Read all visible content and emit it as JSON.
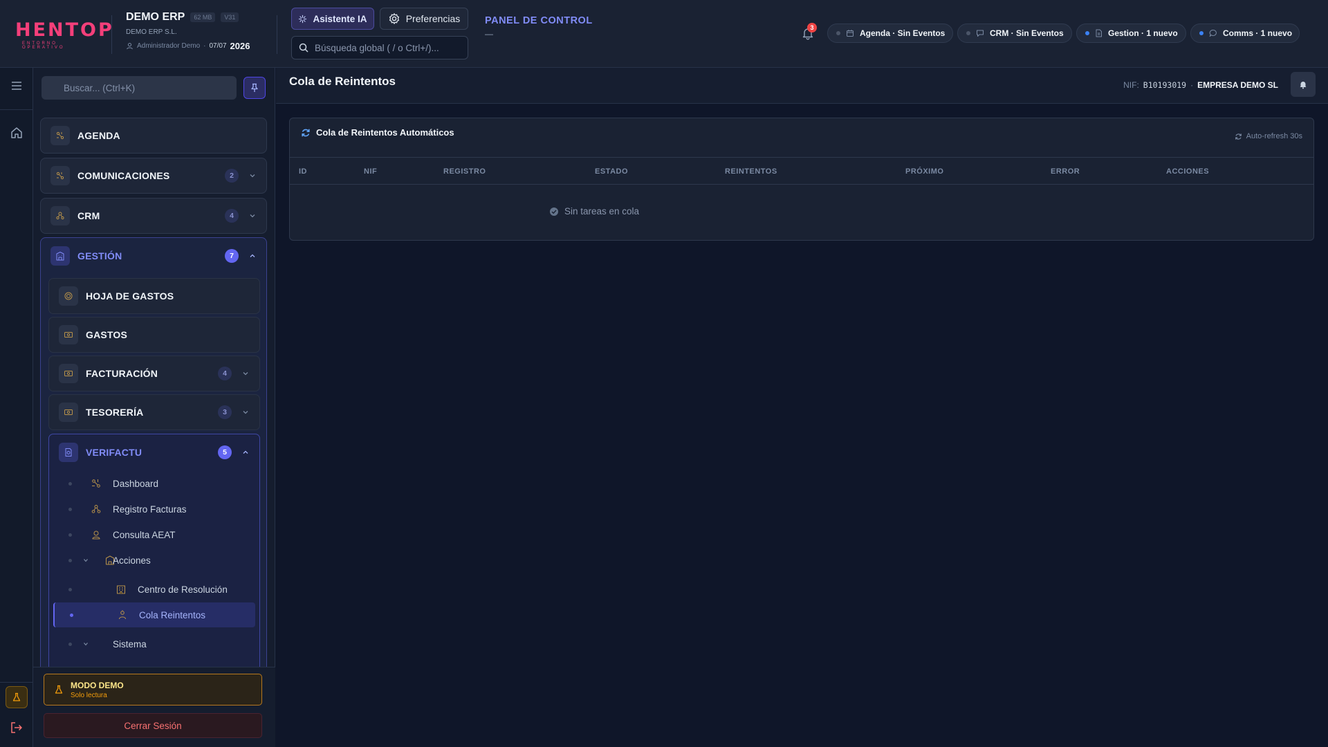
{
  "header": {
    "logo": "HENTOP",
    "logo_sub": "ENTORNO OPERATIVO",
    "app_title": "DEMO ERP",
    "memory_tag": "62 MB",
    "version_tag": "V31",
    "company": "DEMO ERP S.L.",
    "user": "Administrador Demo",
    "date": "07/07",
    "year": "2026",
    "ai_button": "Asistente IA",
    "prefs_button": "Preferencias",
    "search_placeholder": "Búsqueda global ( / o Ctrl+/)...",
    "panel_title": "PANEL DE CONTROL",
    "panel_sub": "—",
    "notifications_count": "3",
    "pills": [
      {
        "label": "Agenda · Sin Eventos",
        "icon": "calendar-icon",
        "status": "idle"
      },
      {
        "label": "CRM · Sin Eventos",
        "icon": "chat-icon",
        "status": "idle"
      },
      {
        "label": "Gestion · 1 nuevo",
        "icon": "document-icon",
        "status": "new"
      },
      {
        "label": "Comms · 1 nuevo",
        "icon": "message-icon",
        "status": "new"
      }
    ]
  },
  "sidebar": {
    "search_placeholder": "Buscar... (Ctrl+K)",
    "modules": [
      {
        "label": "AGENDA"
      },
      {
        "label": "COMUNICACIONES",
        "count": "2"
      },
      {
        "label": "CRM",
        "count": "4"
      }
    ],
    "gestion": {
      "label": "GESTIÓN",
      "count": "7",
      "subs": [
        {
          "label": "HOJA DE GASTOS"
        },
        {
          "label": "GASTOS"
        },
        {
          "label": "FACTURACIÓN",
          "count": "4"
        },
        {
          "label": "TESORERÍA",
          "count": "3"
        }
      ],
      "verifactu": {
        "label": "VERIFACTU",
        "count": "5",
        "items": [
          {
            "label": "Dashboard"
          },
          {
            "label": "Registro Facturas"
          },
          {
            "label": "Consulta AEAT"
          },
          {
            "label": "Acciones"
          },
          {
            "label": "Centro de Resolución"
          },
          {
            "label": "Cola Reintentos"
          },
          {
            "label": "Sistema"
          }
        ]
      }
    },
    "demo_title": "MODO DEMO",
    "demo_sub": "Solo lectura",
    "logout": "Cerrar Sesión"
  },
  "main": {
    "title": "Cola de Reintentos",
    "nif_label": "NIF:",
    "nif_value": "B10193019",
    "separator": "·",
    "company": "EMPRESA DEMO SL",
    "card_title": "Cola de Reintentos Automáticos",
    "auto_refresh": "Auto-refresh 30s",
    "columns": [
      "ID",
      "NIF",
      "REGISTRO",
      "ESTADO",
      "REINTENTOS",
      "PRÓXIMO",
      "ERROR",
      "ACCIONES"
    ],
    "empty_text": "Sin tareas en cola"
  },
  "colors": {
    "accent": "#6366f1",
    "accent_text": "#818cf8",
    "brand": "#f43f7a",
    "danger": "#ef4444",
    "warning": "#f59e0b",
    "background": "#0f1629",
    "surface": "#1a2233"
  }
}
